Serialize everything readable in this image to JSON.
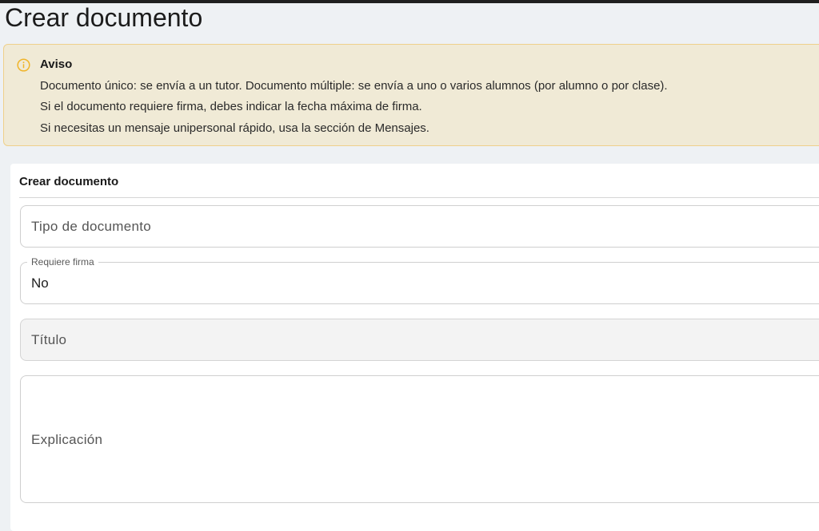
{
  "page": {
    "title": "Crear documento"
  },
  "notice": {
    "icon": "info-circle-icon",
    "icon_color": "#f0b429",
    "heading": "Aviso",
    "lines": [
      "Documento único: se envía a un tutor. Documento múltiple: se envía a uno o varios alumnos (por alumno o por clase).",
      "Si el documento requiere firma, debes indicar la fecha máxima de firma.",
      "Si necesitas un mensaje unipersonal rápido, usa la sección de Mensajes."
    ]
  },
  "form": {
    "title": "Crear documento",
    "document_type": {
      "placeholder": "Tipo de documento"
    },
    "requires_signature": {
      "label": "Requiere firma",
      "value": "No"
    },
    "doc_title": {
      "placeholder": "Título"
    },
    "explanation": {
      "placeholder": "Explicación"
    }
  }
}
